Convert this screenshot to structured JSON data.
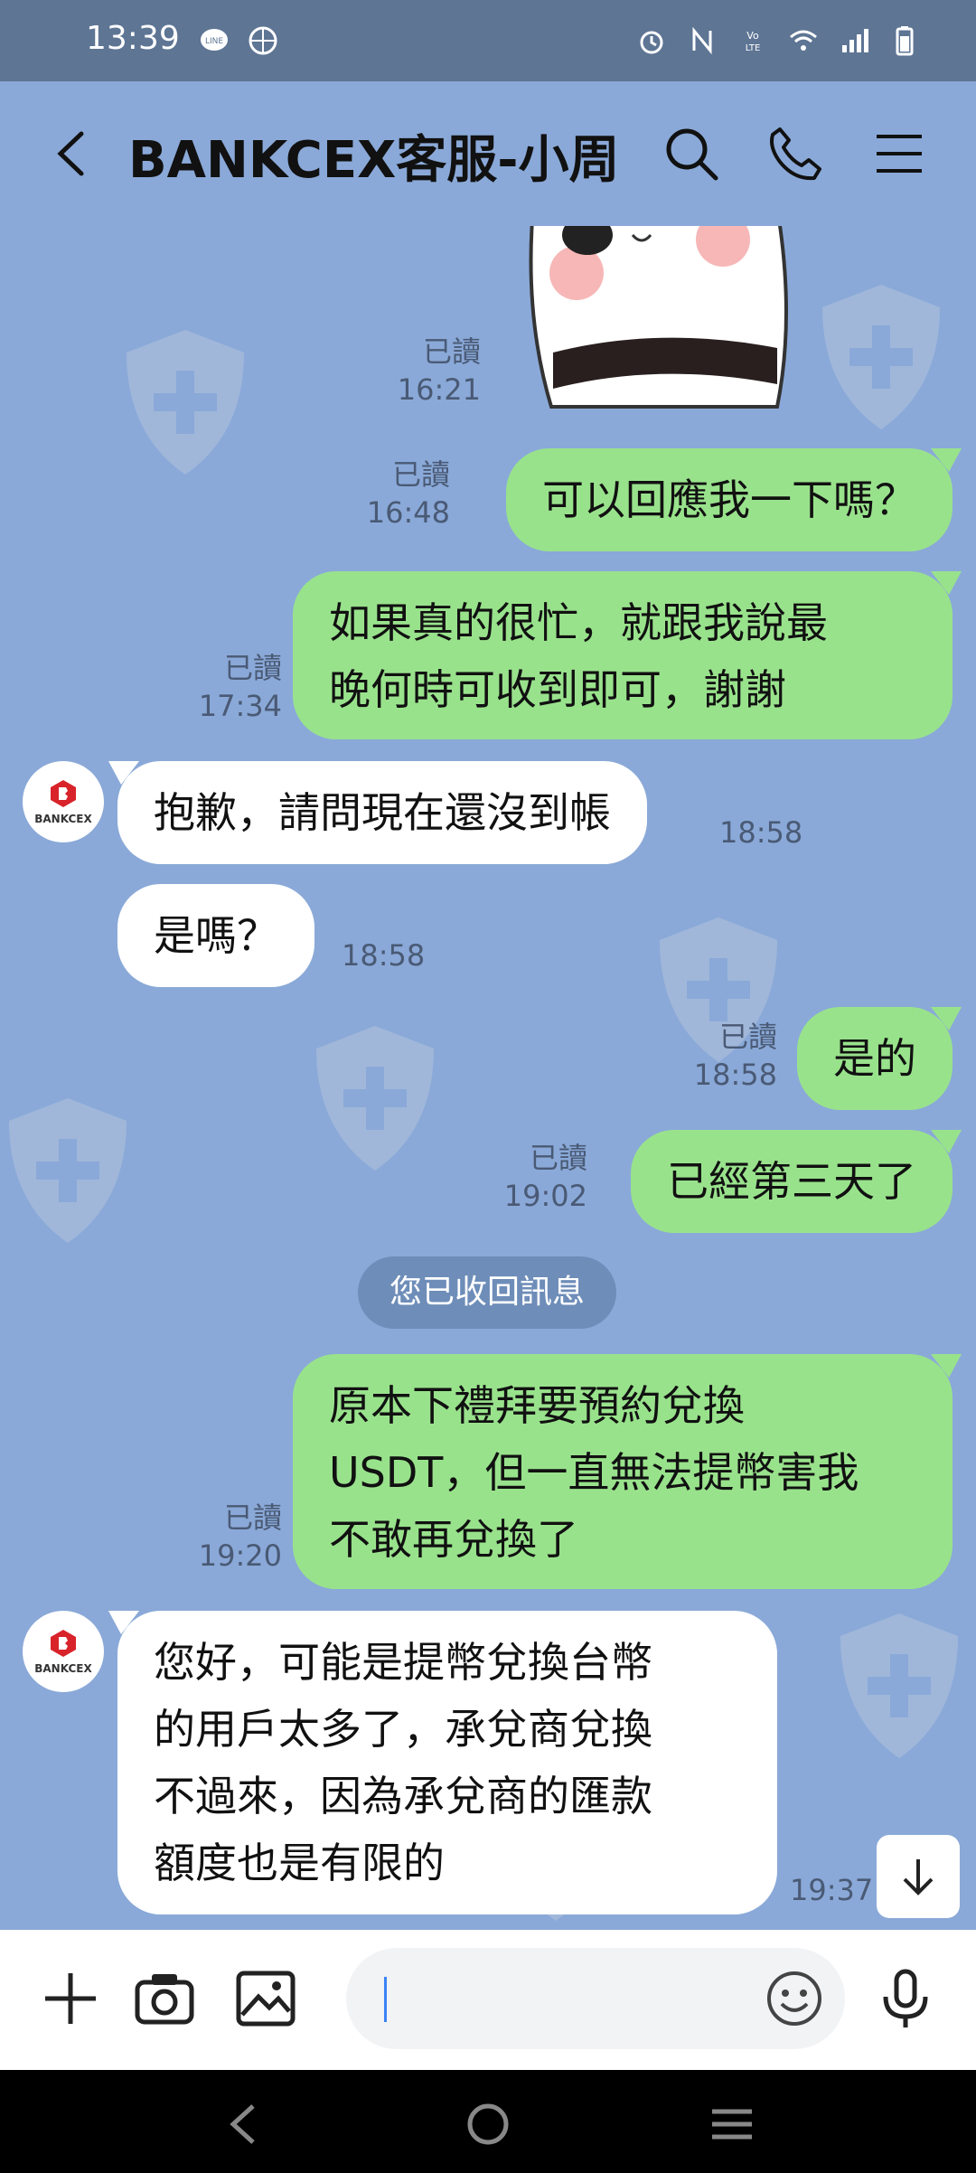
{
  "status_bar": {
    "time": "13:39"
  },
  "header": {
    "title": "BANKCEX客服-小周"
  },
  "messages": {
    "m1": {
      "read": "已讀",
      "time": "16:21"
    },
    "m2": {
      "text": "可以回應我一下嗎？",
      "read": "已讀",
      "time": "16:48"
    },
    "m3": {
      "line1": "如果真的很忙，就跟我說最",
      "line2": "晚何時可收到即可，謝謝",
      "read": "已讀",
      "time": "17:34"
    },
    "m4": {
      "text": "抱歉，請問現在還沒到帳",
      "time": "18:58"
    },
    "m5": {
      "text": "是嗎？",
      "time": "18:58"
    },
    "m6": {
      "text": "是的",
      "read": "已讀",
      "time": "18:58"
    },
    "m7": {
      "text": "已經第三天了",
      "read": "已讀",
      "time": "19:02"
    },
    "system": {
      "text": "您已收回訊息"
    },
    "m8": {
      "line1": "原本下禮拜要預約兌換",
      "line2": "USDT，但一直無法提幣害我",
      "line3": "不敢再兌換了",
      "read": "已讀",
      "time": "19:20"
    },
    "m9": {
      "line1": "您好，可能是提幣兌換台幣",
      "line2": "的用戶太多了，承兌商兌換",
      "line3": "不過來，因為承兌商的匯款",
      "line4": "額度也是有限的",
      "time": "19:37"
    }
  },
  "agent_avatar": {
    "logo_text": "BANKCEX"
  },
  "colors": {
    "chat_bg": "#8aa9d8",
    "outgoing": "#99e28c",
    "incoming": "#ffffff",
    "status_bar": "#5e7594"
  },
  "icons": [
    "back-icon",
    "search-icon",
    "phone-icon",
    "menu-icon",
    "plus-icon",
    "camera-icon",
    "image-icon",
    "emoji-icon",
    "mic-icon",
    "arrow-down-icon"
  ]
}
